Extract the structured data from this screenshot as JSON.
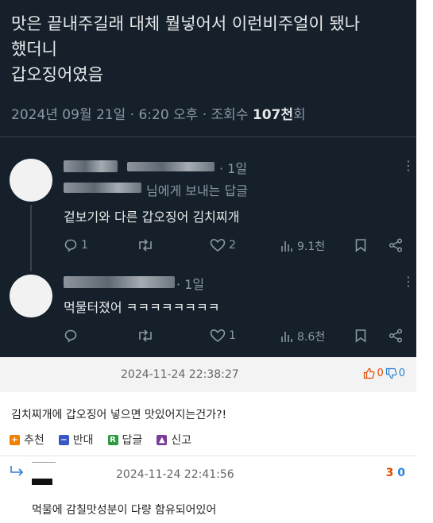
{
  "tweet": {
    "text_line1": "맛은 끝내주길래 대체 뭘넣어서 이런비주얼이 됐나",
    "text_line2": "했더니",
    "text_line3": "갑오징어였음",
    "meta_prefix": "2024년 09월 21일 · 6:20 오후 · 조회수 ",
    "views": "107천",
    "meta_suffix": "회",
    "colors": {
      "background": "#15202b",
      "text": "#e7e9ea",
      "secondary": "#8b98a5"
    }
  },
  "replies": [
    {
      "time": "· 1일",
      "reply_to": "님에게 보내는 답글",
      "text": "겉보기와 다른 갑오징어 김치찌개",
      "counts": {
        "comments": "1",
        "retweets": "",
        "likes": "2",
        "views": "9.1천"
      }
    },
    {
      "time": "· 1일",
      "text": "먹물터졌어 ㅋㅋㅋㅋㅋㅋㅋㅋ",
      "counts": {
        "comments": "",
        "retweets": "",
        "likes": "1",
        "views": "8.6천"
      }
    }
  ],
  "comment": {
    "date": "2024-11-24 22:38:27",
    "up": "0",
    "down": "0",
    "text": "김치찌개에 갑오징어 넣으면 맛있어지는건가?!",
    "buttons": {
      "recommend": "추천",
      "oppose": "반대",
      "reply": "답글",
      "report": "신고"
    },
    "colors": {
      "recommend": "#f08200",
      "oppose": "#3a56c5",
      "reply": "#2e9a3f",
      "report": "#7a3b9a",
      "votes": "#e04a00"
    }
  },
  "sub_reply": {
    "date": "2024-11-24 22:41:56",
    "up": "3",
    "down": "0",
    "text": "먹물에 감칠맛성분이 다량 함유되어있어"
  }
}
